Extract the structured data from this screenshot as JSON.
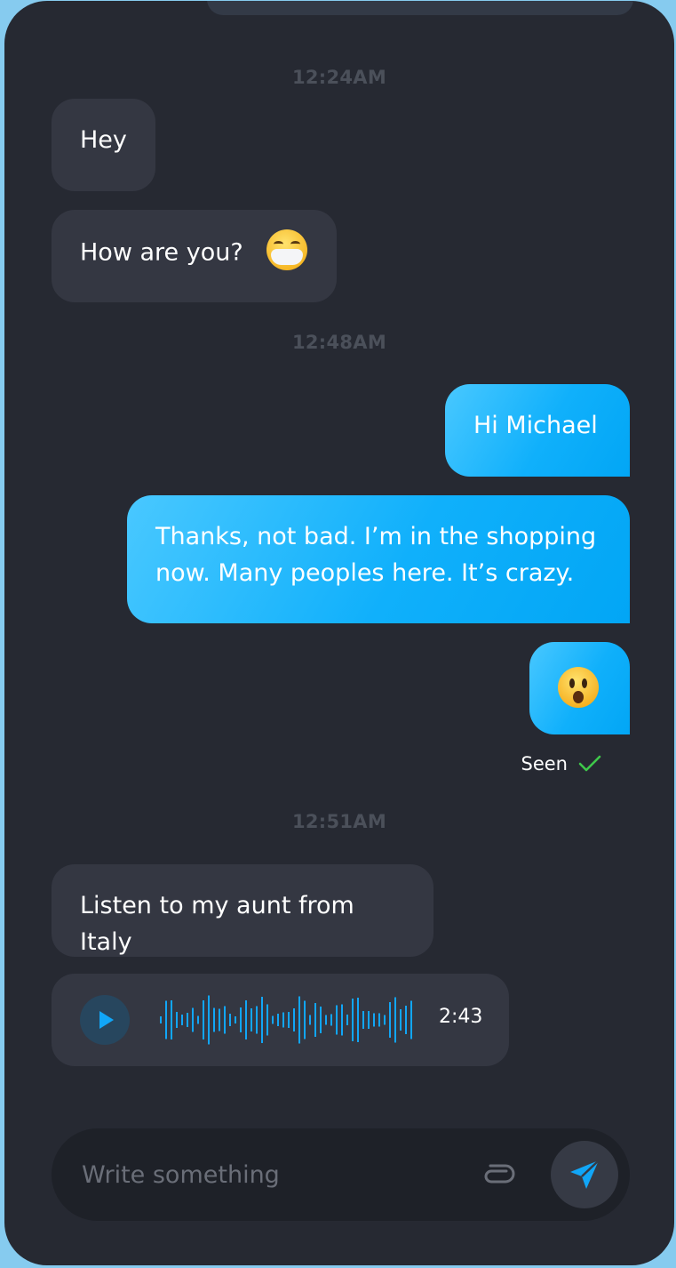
{
  "timestamps": [
    "12:24AM",
    "12:48AM",
    "12:51AM"
  ],
  "messages": {
    "in_1": "Hey",
    "in_2": "How are you?",
    "out_1": "Hi Michael",
    "out_2_line1": "Thanks, not bad. I’m in the shopping",
    "out_2_line2": "now. Many peoples here. It’s crazy.",
    "in_3": "Listen to my aunt from Italy"
  },
  "status": {
    "seen_label": "Seen"
  },
  "voice_message": {
    "duration": "2:43"
  },
  "composer": {
    "placeholder": "Write something"
  },
  "icons": {
    "in_2_emoji": "face-with-medical-mask-emoji",
    "out_3_emoji": "hushed-face-emoji",
    "seen": "check-icon",
    "play": "play-icon",
    "attach": "paperclip-icon",
    "send": "paper-plane-icon"
  },
  "colors": {
    "background": "#262932",
    "incoming_bubble": "#343742",
    "outgoing_bubble": "#10b0fb",
    "accent": "#11a6f7",
    "seen_check": "#3ec84a"
  }
}
